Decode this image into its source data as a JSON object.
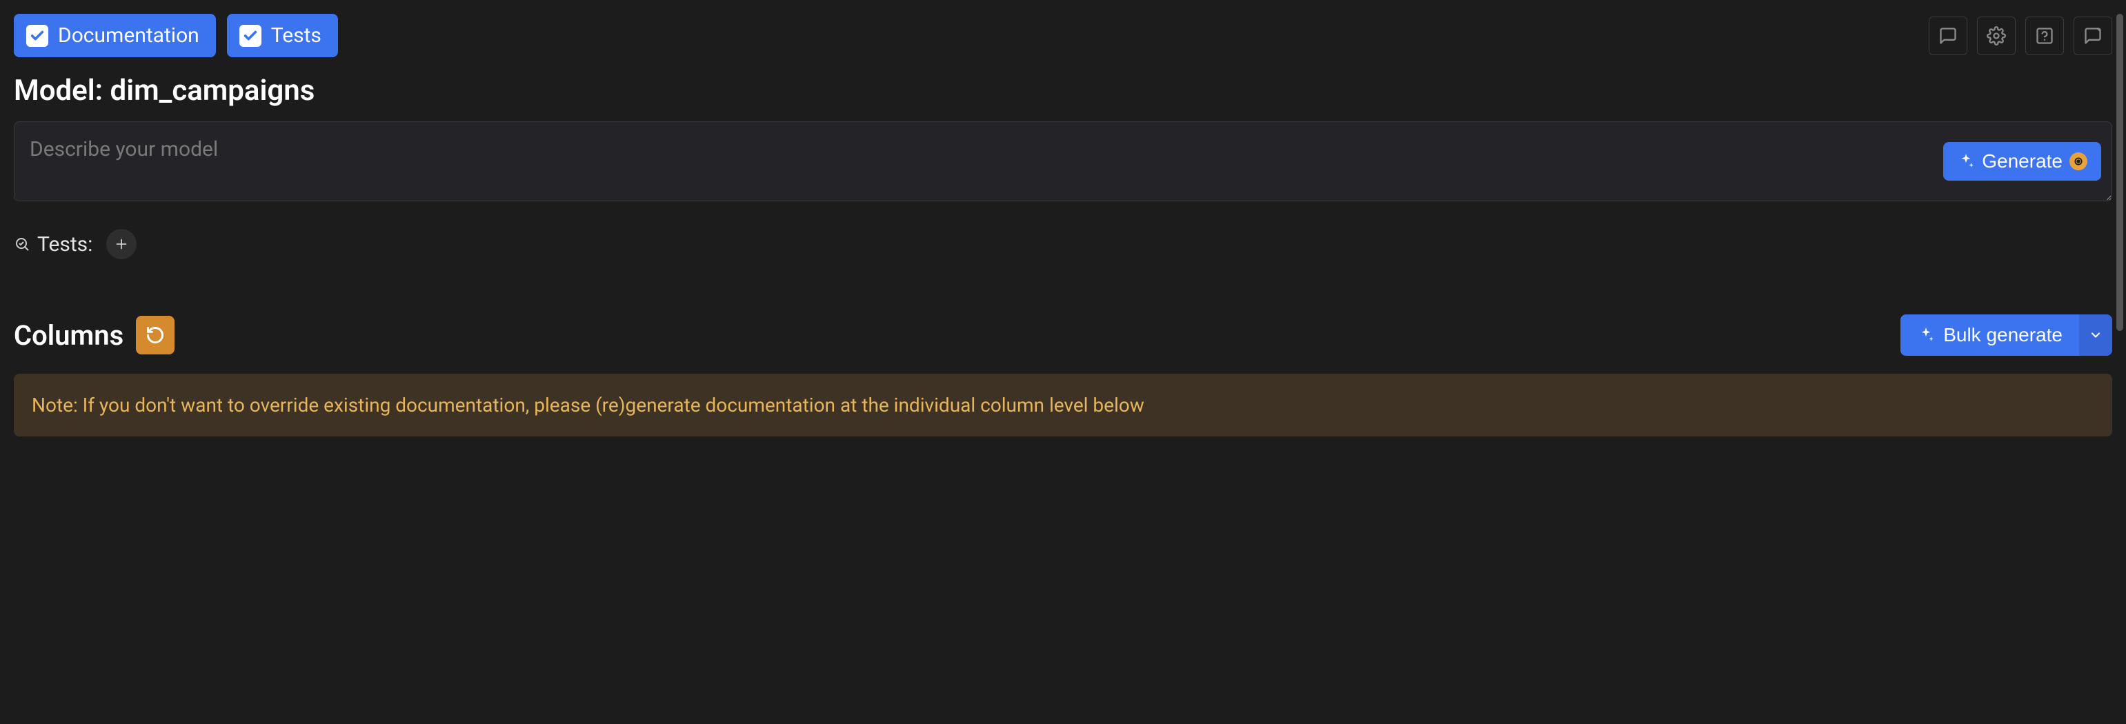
{
  "chips": {
    "documentation": "Documentation",
    "tests": "Tests"
  },
  "heading": "Model: dim_campaigns",
  "desc_placeholder": "Describe your model",
  "generate_label": "Generate",
  "tests_label": "Tests:",
  "columns_heading": "Columns",
  "bulk_generate_label": "Bulk generate",
  "warning_text": "Note: If you don't want to override existing documentation, please (re)generate documentation at the individual column level below"
}
